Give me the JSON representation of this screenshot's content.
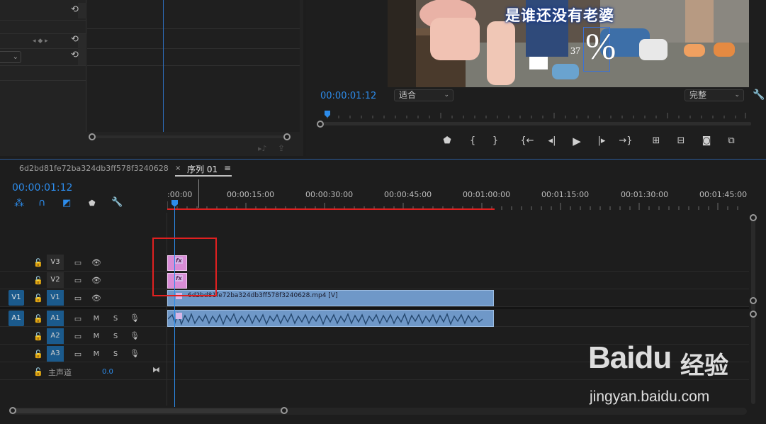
{
  "program": {
    "subtitle": "是谁还没有老婆",
    "overlay_symbol": "%",
    "overlay_number": "37",
    "timecode": "00:00:01:12",
    "fit_dropdown": "适合",
    "quality_dropdown": "完整"
  },
  "timeline": {
    "source_clip_name": "6d2bd81fe72ba324db3ff578f3240628",
    "sequence_tab": "序列 01",
    "sequence_tab_close": "×",
    "sequence_tab_menu": "≡",
    "timecode": "00:00:01:12",
    "ruler_labels": [
      ":00:00",
      "00:00:15:00",
      "00:00:30:00",
      "00:00:45:00",
      "00:01:00:00",
      "00:01:15:00",
      "00:01:30:00",
      "00:01:45:00"
    ],
    "tracks": {
      "v3": "V3",
      "v2": "V2",
      "v1": "V1",
      "a1": "A1",
      "a2": "A2",
      "a3": "A3",
      "v1_source": "V1",
      "a1_source": "A1"
    },
    "mute": "M",
    "solo": "S",
    "master_label": "主声道",
    "master_value": "0.0",
    "video_clip_label": "6d2bd81fe72ba324db3ff578f3240628.mp4 [V]",
    "fx_label": "fx"
  },
  "watermark": {
    "brand": "Baidu",
    "sub": "经验",
    "url": "jingyan.baidu.com"
  },
  "colors": {
    "accent": "#2d8ceb",
    "track_target": "#1b5a8c",
    "video_clip": "#6f98c8",
    "fx_clip": "#d98cd6",
    "work_area": "#e02020",
    "highlight_box": "#e02020"
  }
}
